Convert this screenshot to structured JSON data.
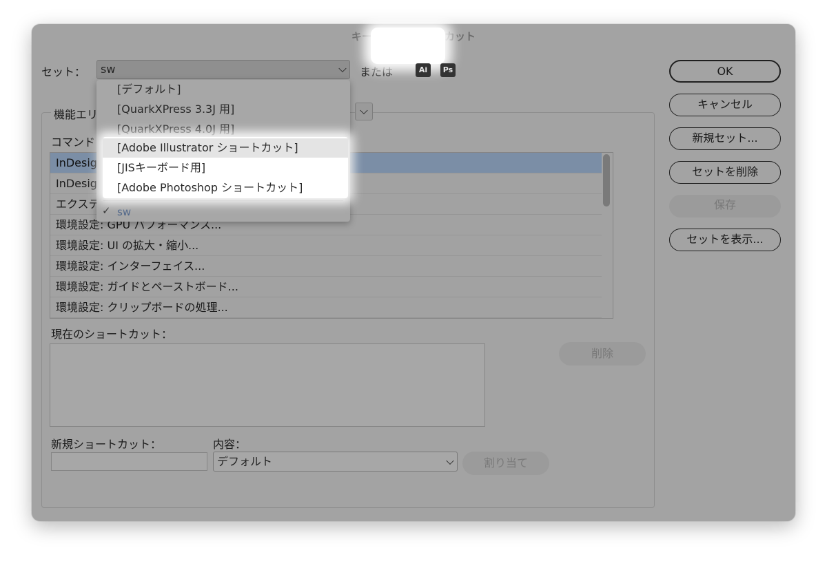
{
  "dialog": {
    "title": "キーボードショートカット"
  },
  "set": {
    "label": "セット：",
    "value": "sw",
    "or_label": "または",
    "apps": [
      {
        "name": "ai-icon",
        "text": "Ai"
      },
      {
        "name": "ps-icon",
        "text": "Ps"
      }
    ]
  },
  "dropdown": {
    "items": [
      "[デフォルト]",
      "[QuarkXPress 3.3J 用]",
      "[QuarkXPress 4.0J 用]",
      "[Adobe Illustrator ショートカット]",
      "[JISキーボード用]",
      "[Adobe Photoshop ショートカット]"
    ],
    "checked_item": "sw",
    "checkmark": "✓"
  },
  "area": {
    "label_partial": "機能エリ"
  },
  "commands": {
    "label_partial": "コマンド",
    "rows": [
      "InDesig",
      "InDesig",
      "エクステ",
      "環境設定: GPU パフォーマンス...",
      "環境設定: UI の拡大・縮小...",
      "環境設定: インターフェイス...",
      "環境設定: ガイドとペーストボード...",
      "環境設定: クリップボードの処理..."
    ]
  },
  "current": {
    "label": "現在のショートカット：",
    "delete_button": "削除"
  },
  "new_shortcut": {
    "label": "新規ショートカット：",
    "value": ""
  },
  "context": {
    "label": "内容：",
    "value": "デフォルト",
    "assign_button": "割り当て"
  },
  "buttons": {
    "ok": "OK",
    "cancel": "キャンセル",
    "new_set": "新規セット...",
    "delete_set": "セットを削除",
    "save": "保存",
    "show_set": "セットを表示..."
  }
}
